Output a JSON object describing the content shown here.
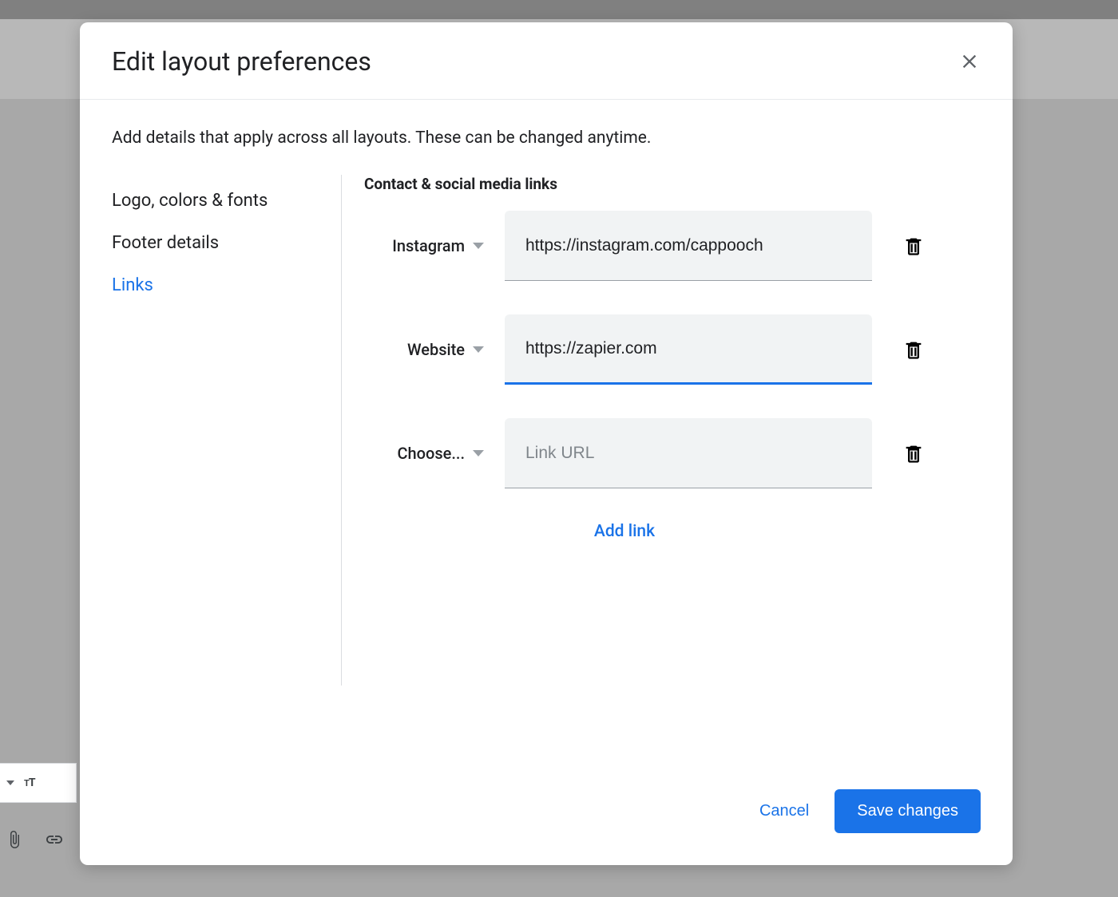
{
  "dialog": {
    "title": "Edit layout preferences",
    "intro": "Add details that apply across all layouts. These can be changed anytime."
  },
  "sidebar": {
    "items": [
      {
        "label": "Logo, colors & fonts",
        "active": false
      },
      {
        "label": "Footer details",
        "active": false
      },
      {
        "label": "Links",
        "active": true
      }
    ]
  },
  "section": {
    "title": "Contact & social media links"
  },
  "links": [
    {
      "type": "Instagram",
      "url": "https://instagram.com/cappooch",
      "placeholder": "Link URL",
      "focused": false
    },
    {
      "type": "Website",
      "url": "https://zapier.com",
      "placeholder": "Link URL",
      "focused": true
    },
    {
      "type": "Choose...",
      "url": "",
      "placeholder": "Link URL",
      "focused": false
    }
  ],
  "actions": {
    "add_link": "Add link",
    "cancel": "Cancel",
    "save": "Save changes"
  }
}
